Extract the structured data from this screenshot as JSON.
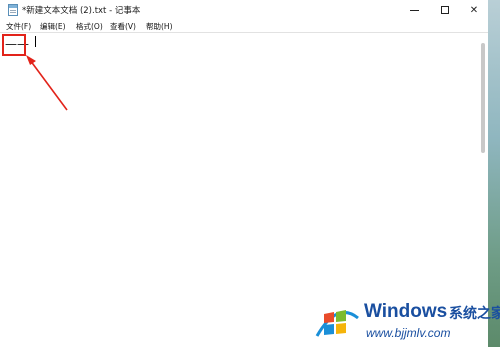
{
  "window": {
    "title": "*新建文本文档 (2).txt - 记事本",
    "controls": {
      "minimize_icon": "minimize-icon",
      "maximize_icon": "maximize-icon",
      "close_label": "✕"
    }
  },
  "menu": {
    "items": [
      "文件(F)",
      "编辑(E)",
      "格式(O)",
      "查看(V)",
      "帮助(H)"
    ]
  },
  "editor": {
    "content": "——"
  },
  "annotation": {
    "box_color": "#e2231a",
    "arrow_color": "#e2231a"
  },
  "watermark": {
    "brand": "Windows",
    "brand_cn": "系统之家",
    "url": "www.bjjmlv.com",
    "logo": "windows-flag-logo"
  }
}
